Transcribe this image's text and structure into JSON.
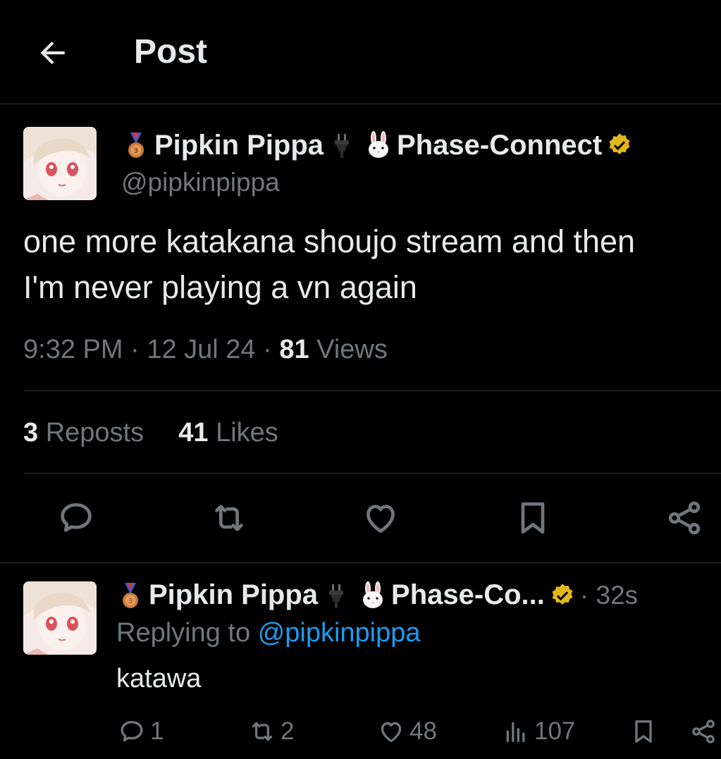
{
  "header": {
    "title": "Post",
    "back_icon": "arrow-left-icon"
  },
  "post": {
    "display_name": "Pipkin Pippa",
    "affiliation": "Phase-Connect",
    "handle": "@pipkinpippa",
    "text_line1": "one more katakana shoujo stream and then",
    "text_line2": "I'm never playing a vn again",
    "time": "9:32 PM",
    "date": "12 Jul 24",
    "views_count": "81",
    "views_label": "Views",
    "reposts_count": "3",
    "reposts_label": "Reposts",
    "likes_count": "41",
    "likes_label": "Likes"
  },
  "reply": {
    "display_name": "Pipkin Pippa",
    "affiliation": "Phase-Co...",
    "time_ago": "32s",
    "replying_prefix": "Replying to",
    "replying_handle": "@pipkinpippa",
    "text": "katawa",
    "reply_count": "1",
    "repost_count": "2",
    "like_count": "48",
    "view_count": "107"
  },
  "colors": {
    "background": "#000000",
    "text": "#e7e9ea",
    "muted": "#71767b",
    "accent": "#1d9bf0",
    "verified": "#e2b719",
    "divider": "#2f3336"
  }
}
